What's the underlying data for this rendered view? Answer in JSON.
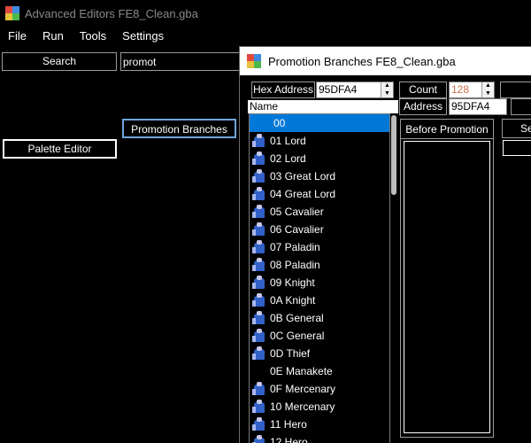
{
  "main_window": {
    "title": "Advanced Editors FE8_Clean.gba",
    "menu": [
      {
        "label": "File"
      },
      {
        "label": "Run"
      },
      {
        "label": "Tools"
      },
      {
        "label": "Settings"
      }
    ],
    "search_label": "Search",
    "search_value": "promot",
    "buttons": {
      "promotion_branches": "Promotion Branches",
      "palette_editor": "Palette Editor"
    }
  },
  "child_window": {
    "title": "Promotion Branches FE8_Clean.gba",
    "hex_address_label": "Hex Address",
    "hex_address_value": "95DFA4",
    "count_label": "Count",
    "count_value": "128",
    "name_header": "Name",
    "address_label": "Address",
    "address_value": "95DFA4",
    "before_promotion_label": "Before Promotion",
    "right_group_label": "Se",
    "list": [
      {
        "label": "00",
        "sprite": "none",
        "selected": true
      },
      {
        "label": "01 Lord",
        "sprite": "lord-sprite-icon"
      },
      {
        "label": "02 Lord",
        "sprite": "lord-sprite-icon"
      },
      {
        "label": "03 Great Lord",
        "sprite": "great-lord-sprite-icon"
      },
      {
        "label": "04 Great Lord",
        "sprite": "great-lord-sprite-icon"
      },
      {
        "label": "05 Cavalier",
        "sprite": "cavalier-sprite-icon"
      },
      {
        "label": "06 Cavalier",
        "sprite": "cavalier-sprite-icon"
      },
      {
        "label": "07 Paladin",
        "sprite": "paladin-sprite-icon"
      },
      {
        "label": "08 Paladin",
        "sprite": "paladin-sprite-icon"
      },
      {
        "label": "09 Knight",
        "sprite": "knight-sprite-icon"
      },
      {
        "label": "0A Knight",
        "sprite": "knight-sprite-icon"
      },
      {
        "label": "0B General",
        "sprite": "general-sprite-icon"
      },
      {
        "label": "0C General",
        "sprite": "general-sprite-icon"
      },
      {
        "label": "0D Thief",
        "sprite": "thief-sprite-icon"
      },
      {
        "label": "0E Manakete",
        "sprite": "none"
      },
      {
        "label": "0F Mercenary",
        "sprite": "mercenary-sprite-icon"
      },
      {
        "label": "10 Mercenary",
        "sprite": "mercenary-sprite-icon"
      },
      {
        "label": "11 Hero",
        "sprite": "hero-sprite-icon"
      },
      {
        "label": "12 Hero",
        "sprite": "hero-sprite-icon"
      }
    ]
  }
}
